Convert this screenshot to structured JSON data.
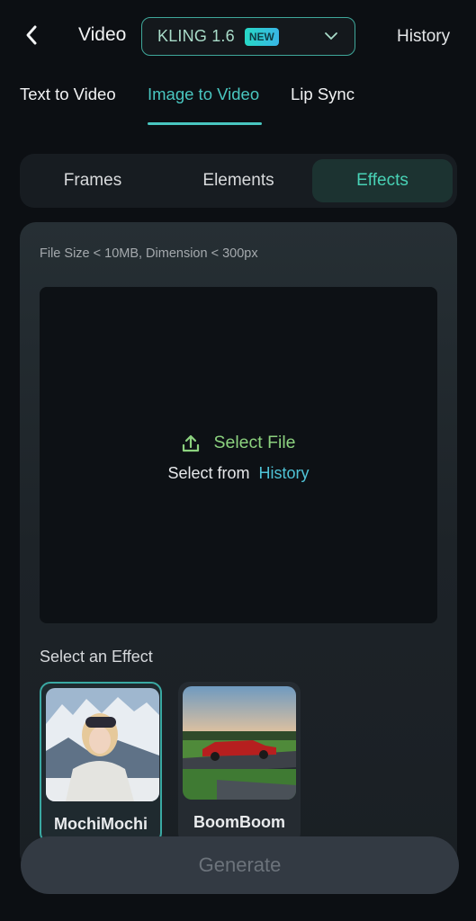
{
  "header": {
    "title": "Video",
    "model": {
      "name": "KLING 1.6",
      "badge": "NEW"
    },
    "history_label": "History"
  },
  "tabs": [
    {
      "label": "Text to Video",
      "active": false
    },
    {
      "label": "Image to Video",
      "active": true
    },
    {
      "label": "Lip Sync",
      "active": false
    }
  ],
  "segments": [
    {
      "label": "Frames",
      "active": false
    },
    {
      "label": "Elements",
      "active": false
    },
    {
      "label": "Effects",
      "active": true
    }
  ],
  "upload": {
    "hint": "File Size < 10MB, Dimension < 300px",
    "select_file_label": "Select File",
    "select_from_label": "Select from",
    "history_link_label": "History"
  },
  "effects": {
    "label": "Select an Effect",
    "items": [
      {
        "name": "MochiMochi",
        "selected": true,
        "thumbnail": "person-in-snowy-mountains-with-goggles"
      },
      {
        "name": "BoomBoom",
        "selected": false,
        "thumbnail": "red-vintage-car-on-road"
      }
    ]
  },
  "generate_label": "Generate",
  "colors": {
    "accent": "#49c6c0",
    "effects_active": "#48d2b5",
    "select_file": "#8cd27f",
    "history_link": "#4fc3d6",
    "background": "#0c0f13"
  }
}
